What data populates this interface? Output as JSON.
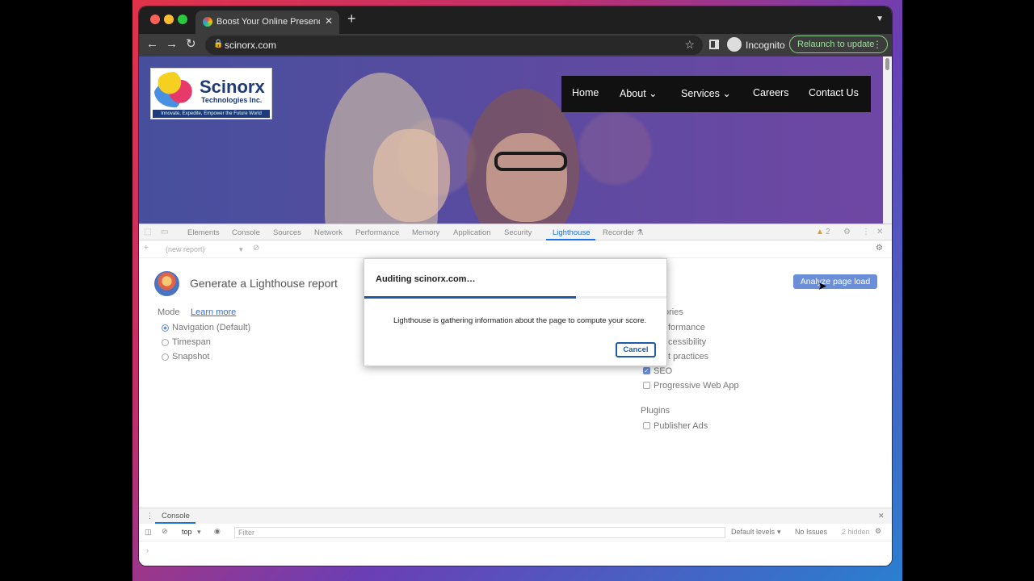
{
  "browser": {
    "tab_title": "Boost Your Online Presence w",
    "url": "scinorx.com",
    "incognito_label": "Incognito",
    "relaunch_label": "Relaunch to update"
  },
  "site": {
    "logo_name": "Scinorx",
    "logo_sub": "Technologies Inc.",
    "logo_tagline": "Innovate, Expedite, Empower the Future World",
    "nav": [
      "Home",
      "About",
      "Services",
      "Careers",
      "Contact Us"
    ]
  },
  "devtools": {
    "tabs": [
      "Elements",
      "Console",
      "Sources",
      "Network",
      "Performance",
      "Memory",
      "Application",
      "Security",
      "Lighthouse",
      "Recorder"
    ],
    "warnings_count": "2",
    "report_select": "(new report)",
    "lighthouse": {
      "title": "Generate a Lighthouse report",
      "analyze_button": "Analyze page load",
      "mode_label": "Mode",
      "learn_more": "Learn more",
      "modes": [
        "Navigation (Default)",
        "Timespan",
        "Snapshot"
      ],
      "categories_label": "ories",
      "categories": [
        "formance",
        "cessibility",
        "t practices",
        "SEO",
        "Progressive Web App"
      ],
      "plugins_label": "Plugins",
      "plugins": [
        "Publisher Ads"
      ]
    },
    "dialog": {
      "title": "Auditing scinorx.com…",
      "message": "Lighthouse is gathering information about the page to compute your score.",
      "cancel": "Cancel",
      "progress": 0.7
    },
    "console": {
      "tab": "Console",
      "context": "top",
      "filter_placeholder": "Filter",
      "levels": "Default levels",
      "issues": "No Issues",
      "hidden": "2 hidden"
    }
  }
}
